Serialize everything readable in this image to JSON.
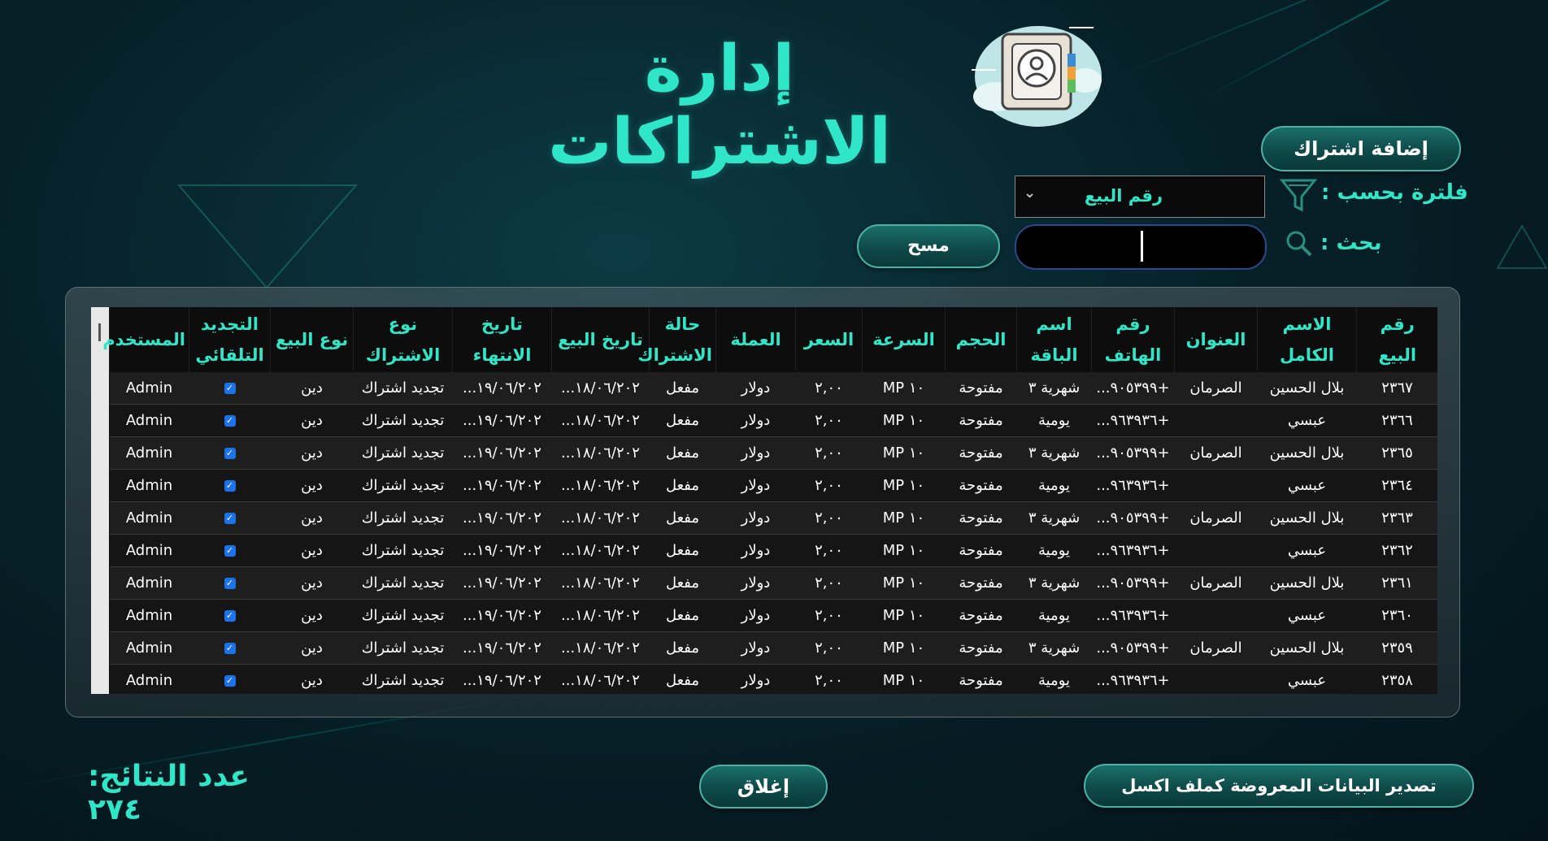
{
  "window": {
    "title": "إدارة الاشتراكات"
  },
  "toolbar": {
    "add_label": "إضافة اشتراك",
    "filter_label": "فلترة بحسب :",
    "filter_value": "رقم البيع",
    "search_label": "بحث :",
    "search_value": "",
    "clear_label": "مسح"
  },
  "table": {
    "columns": [
      "رقم البيع",
      "الاسم الكامل",
      "العنوان",
      "رقم الهاتف",
      "اسم الباقة",
      "الحجم",
      "السرعة",
      "السعر",
      "العملة",
      "حالة الاشتراك",
      "تاريخ البيع",
      "تاريخ الانتهاء",
      "نوع الاشتراك",
      "نوع البيع",
      "التجديد التلقائي",
      "المستخدم"
    ],
    "rows": [
      [
        "٢٣٦٧",
        "بلال الحسين",
        "الصرمان",
        "+٩٠٥٣٩٩...",
        "شهرية ٣",
        "مفتوحة",
        "١٠ MP",
        "٢,٠٠",
        "دولار",
        "مفعل",
        "١٨/٠٦/٢٠٢...",
        "١٩/٠٦/٢٠٢...",
        "تجديد اشتراك",
        "دين",
        "✓",
        "Admin"
      ],
      [
        "٢٣٦٦",
        "عبسي",
        "",
        "+٩٦٣٩٣٦...",
        "يومية",
        "مفتوحة",
        "١٠ MP",
        "٢,٠٠",
        "دولار",
        "مفعل",
        "١٨/٠٦/٢٠٢...",
        "١٩/٠٦/٢٠٢...",
        "تجديد اشتراك",
        "دين",
        "✓",
        "Admin"
      ],
      [
        "٢٣٦٥",
        "بلال الحسين",
        "الصرمان",
        "+٩٠٥٣٩٩...",
        "شهرية ٣",
        "مفتوحة",
        "١٠ MP",
        "٢,٠٠",
        "دولار",
        "مفعل",
        "١٨/٠٦/٢٠٢...",
        "١٩/٠٦/٢٠٢...",
        "تجديد اشتراك",
        "دين",
        "✓",
        "Admin"
      ],
      [
        "٢٣٦٤",
        "عبسي",
        "",
        "+٩٦٣٩٣٦...",
        "يومية",
        "مفتوحة",
        "١٠ MP",
        "٢,٠٠",
        "دولار",
        "مفعل",
        "١٨/٠٦/٢٠٢...",
        "١٩/٠٦/٢٠٢...",
        "تجديد اشتراك",
        "دين",
        "✓",
        "Admin"
      ],
      [
        "٢٣٦٣",
        "بلال الحسين",
        "الصرمان",
        "+٩٠٥٣٩٩...",
        "شهرية ٣",
        "مفتوحة",
        "١٠ MP",
        "٢,٠٠",
        "دولار",
        "مفعل",
        "١٨/٠٦/٢٠٢...",
        "١٩/٠٦/٢٠٢...",
        "تجديد اشتراك",
        "دين",
        "✓",
        "Admin"
      ],
      [
        "٢٣٦٢",
        "عبسي",
        "",
        "+٩٦٣٩٣٦...",
        "يومية",
        "مفتوحة",
        "١٠ MP",
        "٢,٠٠",
        "دولار",
        "مفعل",
        "١٨/٠٦/٢٠٢...",
        "١٩/٠٦/٢٠٢...",
        "تجديد اشتراك",
        "دين",
        "✓",
        "Admin"
      ],
      [
        "٢٣٦١",
        "بلال الحسين",
        "الصرمان",
        "+٩٠٥٣٩٩...",
        "شهرية ٣",
        "مفتوحة",
        "١٠ MP",
        "٢,٠٠",
        "دولار",
        "مفعل",
        "١٨/٠٦/٢٠٢...",
        "١٩/٠٦/٢٠٢...",
        "تجديد اشتراك",
        "دين",
        "✓",
        "Admin"
      ],
      [
        "٢٣٦٠",
        "عبسي",
        "",
        "+٩٦٣٩٣٦...",
        "يومية",
        "مفتوحة",
        "١٠ MP",
        "٢,٠٠",
        "دولار",
        "مفعل",
        "١٨/٠٦/٢٠٢...",
        "١٩/٠٦/٢٠٢...",
        "تجديد اشتراك",
        "دين",
        "✓",
        "Admin"
      ],
      [
        "٢٣٥٩",
        "بلال الحسين",
        "الصرمان",
        "+٩٠٥٣٩٩...",
        "شهرية ٣",
        "مفتوحة",
        "١٠ MP",
        "٢,٠٠",
        "دولار",
        "مفعل",
        "١٨/٠٦/٢٠٢...",
        "١٩/٠٦/٢٠٢...",
        "تجديد اشتراك",
        "دين",
        "✓",
        "Admin"
      ],
      [
        "٢٣٥٨",
        "عبسي",
        "",
        "+٩٦٣٩٣٦...",
        "يومية",
        "مفتوحة",
        "١٠ MP",
        "٢,٠٠",
        "دولار",
        "مفعل",
        "١٨/٠٦/٢٠٢...",
        "١٩/٠٦/٢٠٢...",
        "تجديد اشتراك",
        "دين",
        "✓",
        "Admin"
      ]
    ]
  },
  "footer": {
    "count_label": "عدد النتائج: ٢٧٤",
    "close_label": "إغلاق",
    "export_label": "تصدير البيانات المعروضة كملف اكسل"
  },
  "colors": {
    "accent": "#2fe6c8",
    "button": "#0e4a49",
    "checkbox": "#1a73e8"
  }
}
